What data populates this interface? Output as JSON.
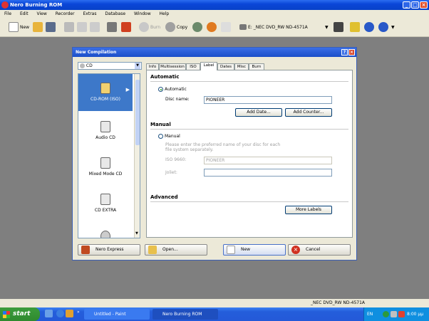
{
  "window": {
    "title": "Nero Burning ROM"
  },
  "menu": [
    "File",
    "Edit",
    "View",
    "Recorder",
    "Extras",
    "Database",
    "Window",
    "Help"
  ],
  "toolbar": {
    "new_label": "New",
    "burn_label": "Burn",
    "copy_label": "Copy",
    "drive_label": "E: _NEC DVD_RW ND-4571A"
  },
  "dialog": {
    "title": "New Compilation",
    "disc_type": "CD",
    "list_items": [
      "CD-ROM (ISO)",
      "Audio CD",
      "Mixed Mode CD",
      "CD EXTRA"
    ],
    "tabs": [
      "Info",
      "Multisession",
      "ISO",
      "Label",
      "Dates",
      "Misc",
      "Burn"
    ],
    "active_tab": "Label",
    "automatic": {
      "section": "Automatic",
      "radio_label": "Automatic",
      "disc_name_label": "Disc name:",
      "disc_name_value": "PIONEER",
      "add_date_label": "Add Date...",
      "add_counter_label": "Add Counter..."
    },
    "manual": {
      "section": "Manual",
      "radio_label": "Manual",
      "hint": "Please enter the preferred name of your disc for each file system separately.",
      "iso_label": "ISO 9660:",
      "iso_value": "PIONEER",
      "joliet_label": "Joliet:",
      "joliet_value": ""
    },
    "advanced": {
      "section": "Advanced",
      "more_labels_label": "More Labels"
    },
    "buttons": {
      "nero_express": "Nero Express",
      "open": "Open...",
      "new": "New",
      "cancel": "Cancel"
    }
  },
  "status": {
    "drive": "_NEC   DVD_RW ND-4571A"
  },
  "taskbar": {
    "start": "start",
    "tasks": [
      "Untitled - Paint",
      "Nero Burning ROM"
    ],
    "lang": "EN",
    "clock": "8:00 μμ"
  }
}
